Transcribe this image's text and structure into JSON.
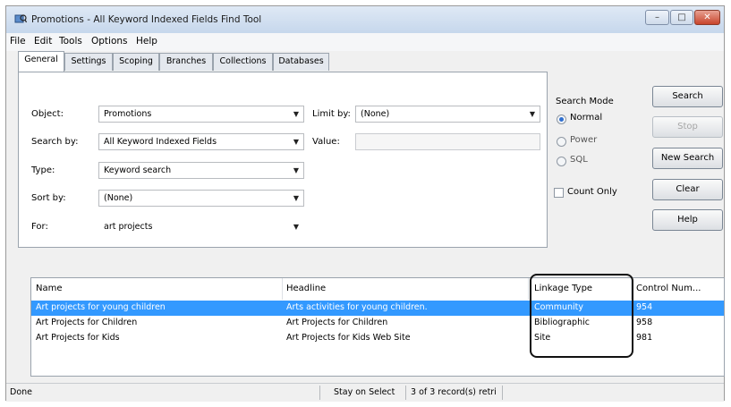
{
  "window": {
    "title": "Promotions - All Keyword Indexed Fields Find Tool"
  },
  "menu": [
    "File",
    "Edit",
    "Tools",
    "Options",
    "Help"
  ],
  "tabs": [
    "General",
    "Settings",
    "Scoping",
    "Branches",
    "Collections",
    "Databases"
  ],
  "form": {
    "object_label": "Object:",
    "object_value": "Promotions",
    "search_by_label": "Search by:",
    "search_by_value": "All Keyword Indexed Fields",
    "type_label": "Type:",
    "type_value": "Keyword search",
    "sort_by_label": "Sort by:",
    "sort_by_value": "(None)",
    "for_label": "For:",
    "for_value": "art projects",
    "limit_by_label": "Limit by:",
    "limit_by_value": "(None)",
    "value_label": "Value:"
  },
  "search_mode": {
    "label": "Search Mode",
    "options": [
      "Normal",
      "Power",
      "SQL"
    ],
    "selected": "Normal"
  },
  "count_only_label": "Count Only",
  "buttons": [
    "Search",
    "Stop",
    "New Search",
    "Clear",
    "Help"
  ],
  "results": {
    "columns": [
      "Name",
      "Headline",
      "Linkage Type",
      "Control Num..."
    ],
    "rows": [
      [
        "Art projects for young children",
        "Arts activities for young children.",
        "Community",
        "954"
      ],
      [
        "Art Projects for Children",
        "Art Projects for Children",
        "Bibliographic",
        "958"
      ],
      [
        "Art Projects for Kids",
        "Art Projects for Kids Web Site",
        "Site",
        "981"
      ]
    ],
    "selected_row": 0
  },
  "status": {
    "left": "Done",
    "mode": "Stay on Select",
    "count": "3 of 3 record(s) retri"
  }
}
